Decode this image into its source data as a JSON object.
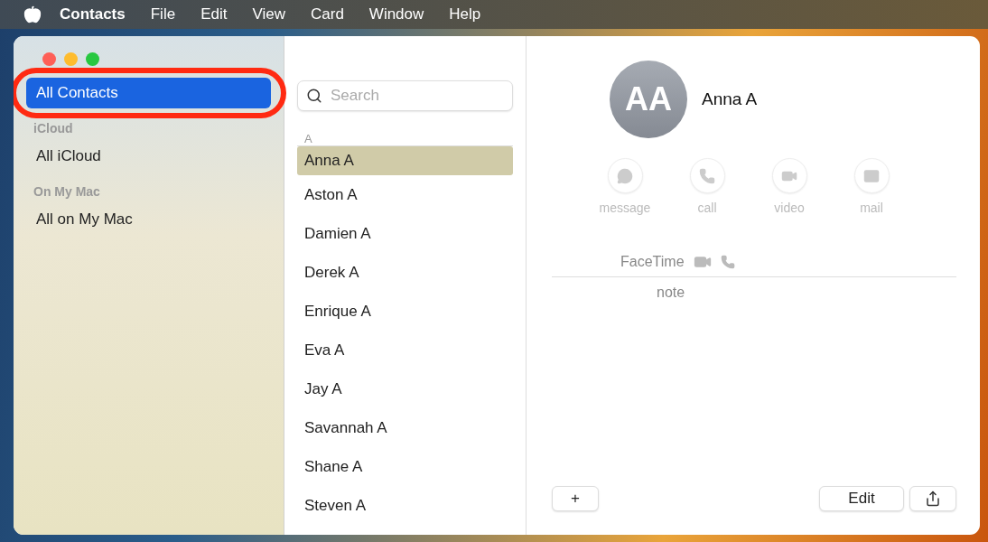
{
  "menubar": {
    "app": "Contacts",
    "items": [
      "File",
      "Edit",
      "View",
      "Card",
      "Window",
      "Help"
    ]
  },
  "sidebar": {
    "items": [
      {
        "kind": "item",
        "label": "All Contacts",
        "selected": true,
        "highlighted": true
      },
      {
        "kind": "heading",
        "label": "iCloud"
      },
      {
        "kind": "item",
        "label": "All iCloud",
        "selected": false,
        "highlighted": false
      },
      {
        "kind": "heading",
        "label": "On My Mac"
      },
      {
        "kind": "item",
        "label": "All on My Mac",
        "selected": false,
        "highlighted": false
      }
    ]
  },
  "list": {
    "search": {
      "placeholder": "Search"
    },
    "section": "A",
    "contacts": [
      {
        "name": "Anna A",
        "selected": true
      },
      {
        "name": "Aston A",
        "selected": false
      },
      {
        "name": "Damien A",
        "selected": false
      },
      {
        "name": "Derek A",
        "selected": false
      },
      {
        "name": "Enrique A",
        "selected": false
      },
      {
        "name": "Eva A",
        "selected": false
      },
      {
        "name": "Jay A",
        "selected": false
      },
      {
        "name": "Savannah A",
        "selected": false
      },
      {
        "name": "Shane A",
        "selected": false
      },
      {
        "name": "Steven A",
        "selected": false
      }
    ]
  },
  "detail": {
    "initials": "AA",
    "name": "Anna A",
    "actions": [
      {
        "kind": "message",
        "label": "message"
      },
      {
        "kind": "call",
        "label": "call"
      },
      {
        "kind": "video",
        "label": "video"
      },
      {
        "kind": "mail",
        "label": "mail"
      }
    ],
    "facetime_label": "FaceTime",
    "note_label": "note",
    "add_button": "+",
    "edit_button": "Edit"
  }
}
